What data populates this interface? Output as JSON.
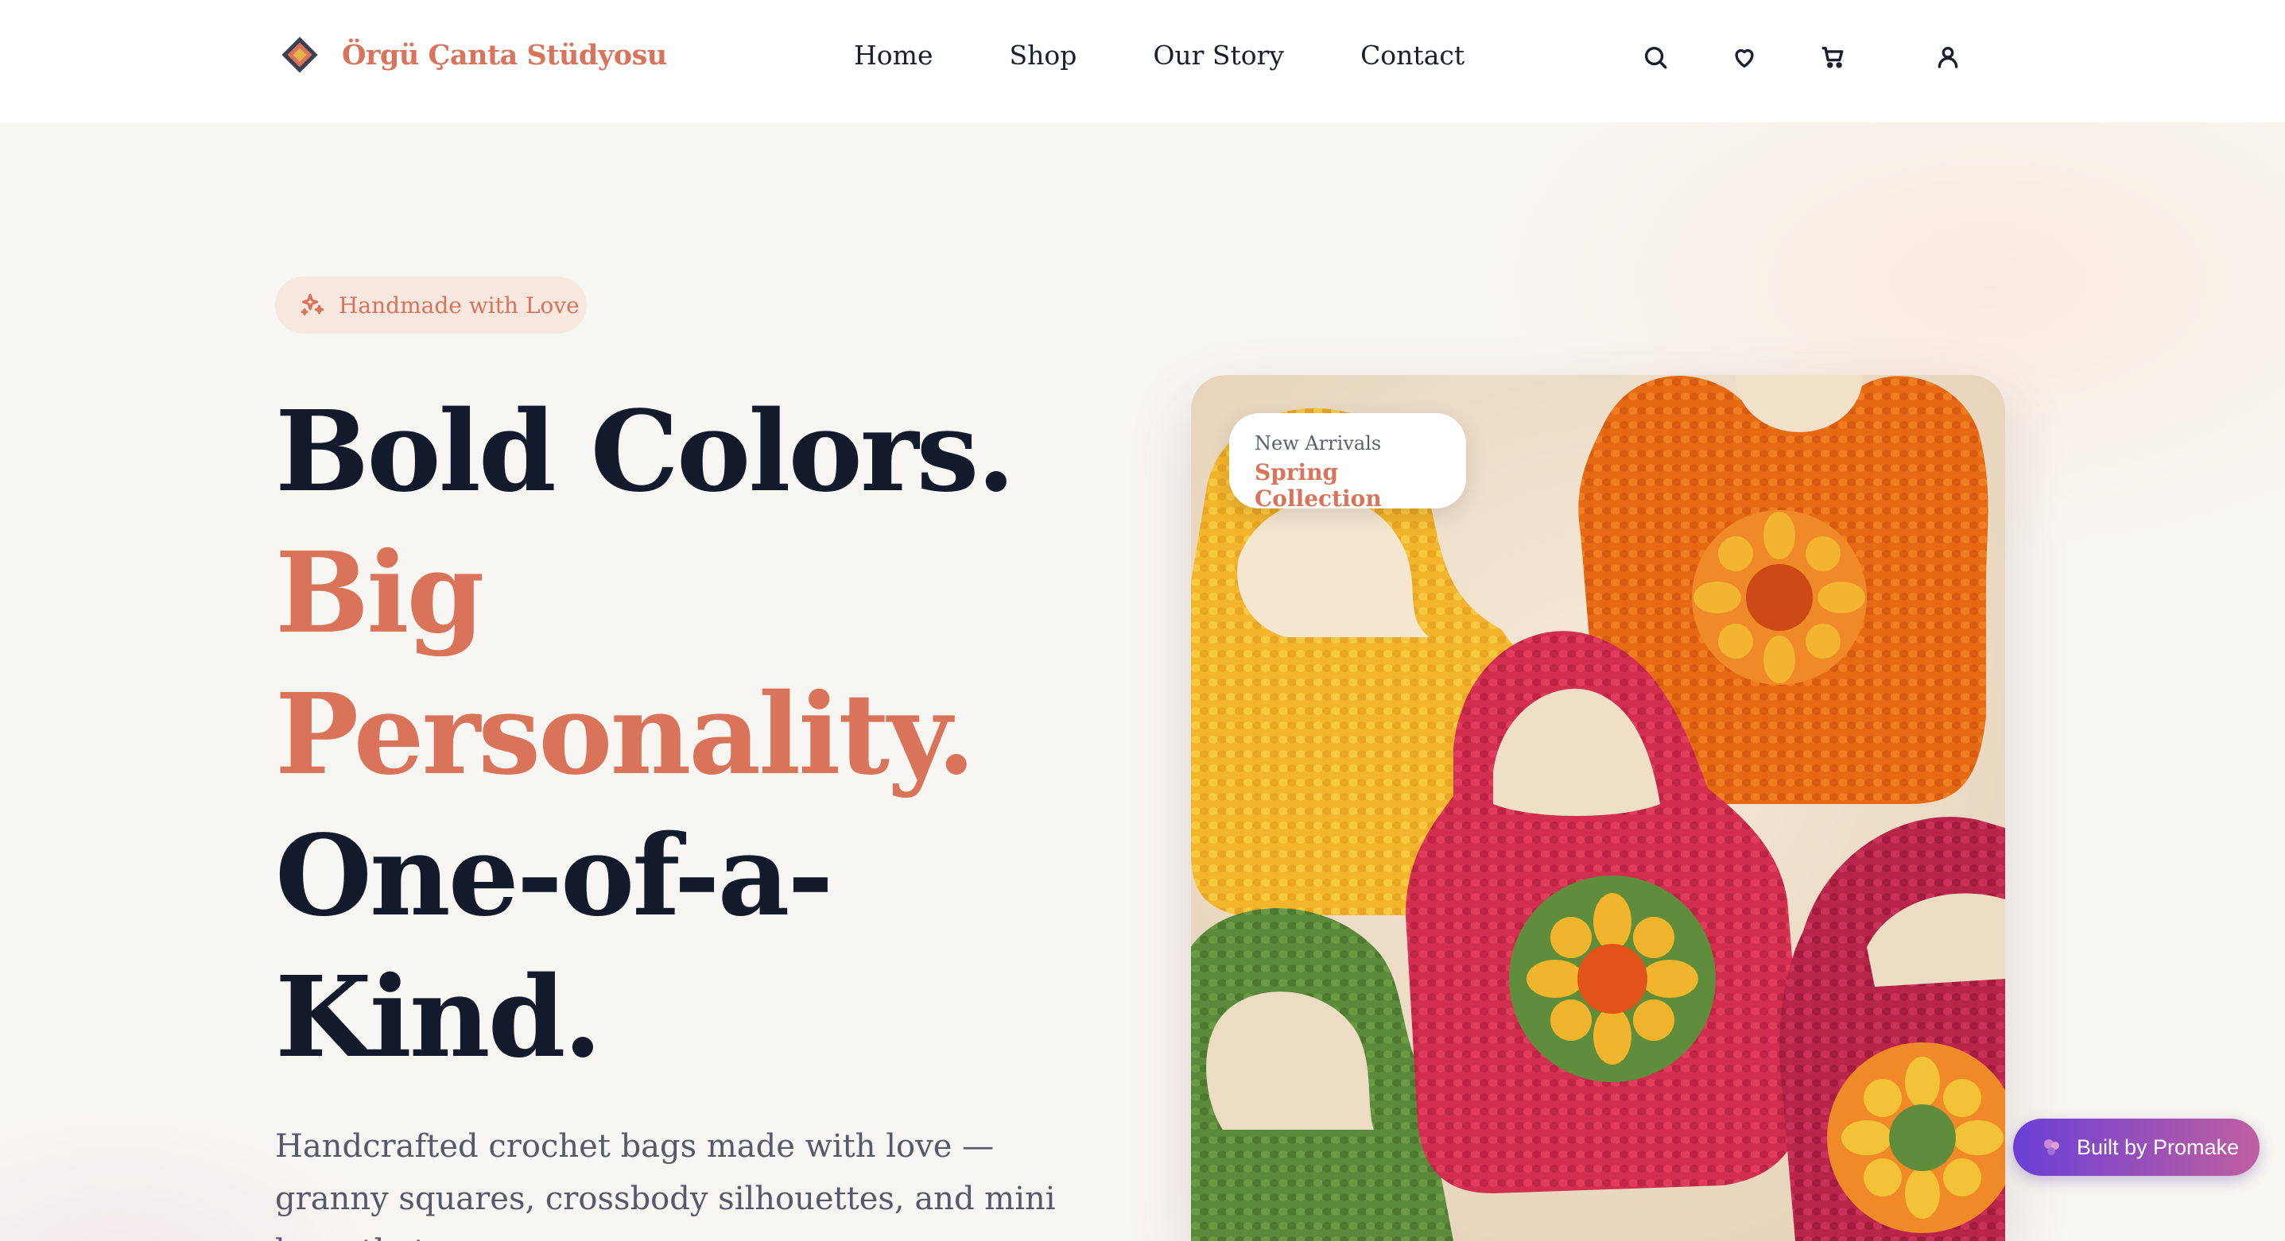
{
  "header": {
    "brand": "Örgü Çanta Stüdyosu",
    "nav": [
      "Home",
      "Shop",
      "Our Story",
      "Contact"
    ],
    "icons": [
      "search-icon",
      "heart-icon",
      "cart-icon",
      "user-icon"
    ]
  },
  "hero": {
    "badge": "Handmade with Love",
    "headline": {
      "line1": "Bold Colors.",
      "line2": "Big",
      "line3": "Personality.",
      "line4": "One-of-a-",
      "line5": "Kind."
    },
    "subtitle": "Handcrafted crochet bags made with love — granny squares, crossbody silhouettes, and mini bags that"
  },
  "card": {
    "tag_small": "New Arrivals",
    "tag_title": "Spring Collection"
  },
  "promake": {
    "label": "Built by Promake"
  },
  "colors": {
    "accent": "#d9745a",
    "dark": "#121a2b",
    "background": "#f8f6f2"
  }
}
